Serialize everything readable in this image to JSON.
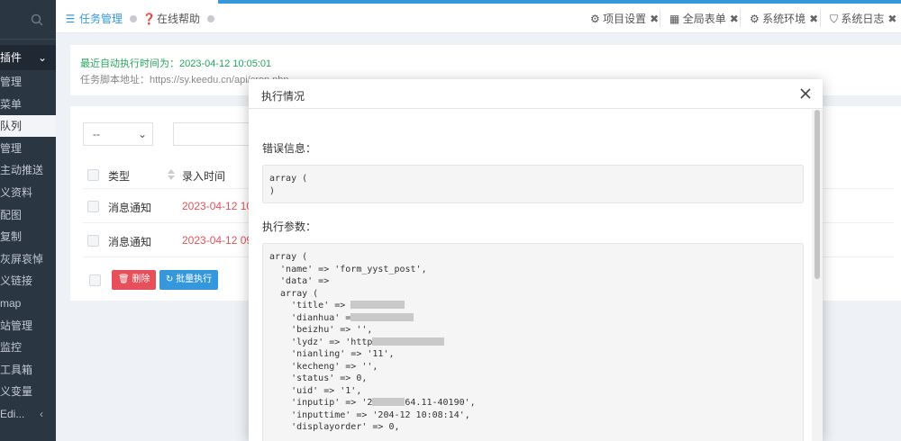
{
  "sidebar": {
    "top_item": "插件",
    "items": [
      {
        "label": "管理",
        "active": false
      },
      {
        "label": "菜单",
        "active": false
      },
      {
        "label": "队列",
        "active": true
      },
      {
        "label": "管理",
        "active": false
      },
      {
        "label": "主动推送",
        "active": false
      },
      {
        "label": "义资料",
        "active": false
      },
      {
        "label": "配图",
        "active": false
      },
      {
        "label": "复制",
        "active": false
      },
      {
        "label": "灰屏哀悼",
        "active": false
      },
      {
        "label": "义链接",
        "active": false
      },
      {
        "label": "map",
        "active": false
      },
      {
        "label": "站管理",
        "active": false
      },
      {
        "label": "监控",
        "active": false
      },
      {
        "label": "工具箱",
        "active": false
      },
      {
        "label": "义变量",
        "active": false
      },
      {
        "label": "Edi...",
        "active": false
      }
    ]
  },
  "tabs": {
    "left": [
      {
        "label": "任务管理",
        "icon": "list-icon"
      },
      {
        "label": "在线帮助",
        "icon": "question-icon"
      }
    ],
    "right": [
      {
        "label": "项目设置",
        "icon": "gear-icon"
      },
      {
        "label": "全局表单",
        "icon": "table-icon"
      },
      {
        "label": "系统环境",
        "icon": "gear-icon"
      },
      {
        "label": "系统日志",
        "icon": "shield-icon"
      }
    ],
    "close_glyph": "✖"
  },
  "info": {
    "last_run": "最近自动执行时间为：2023-04-12 10:05:01",
    "script_url": "任务脚本地址：https://sy.keedu.cn/api/cron.php"
  },
  "filter": {
    "select_value": "--"
  },
  "table": {
    "headers": [
      "类型",
      "录入时间"
    ],
    "rows": [
      {
        "type": "消息通知",
        "time": "2023-04-12 10"
      },
      {
        "type": "消息通知",
        "time": "2023-04-12 09"
      }
    ],
    "delete_label": "删除",
    "batch_label": "批量执行"
  },
  "modal": {
    "title": "执行情况",
    "error_label": "错误信息：",
    "error_code": "array (\n)",
    "params_label": "执行参数：",
    "params_lines": [
      "array (",
      "  'name' => 'form_yyst_post',",
      "  'data' =>",
      "  array (",
      "    'title' => ",
      "    'dianhua' =",
      "    'beizhu' => '',",
      "    'lydz' => 'http",
      "    'nianling' => '11',",
      "    'kecheng' => '',",
      "    'status' => 0,",
      "    'uid' => '1',",
      "    'inputip' => '2",
      "    'inputtime' => '2",
      "    'displayorder' => 0,"
    ],
    "params_tails": [
      "",
      "",
      "",
      "",
      "",
      "",
      "",
      "",
      "",
      "",
      "",
      "",
      "64.11-40190',",
      "04-12 10:08:14',",
      ""
    ]
  },
  "colors": {
    "accent": "#3598dc",
    "danger": "#e7505a",
    "success": "#26a65b",
    "sidebar": "#2b3643"
  }
}
